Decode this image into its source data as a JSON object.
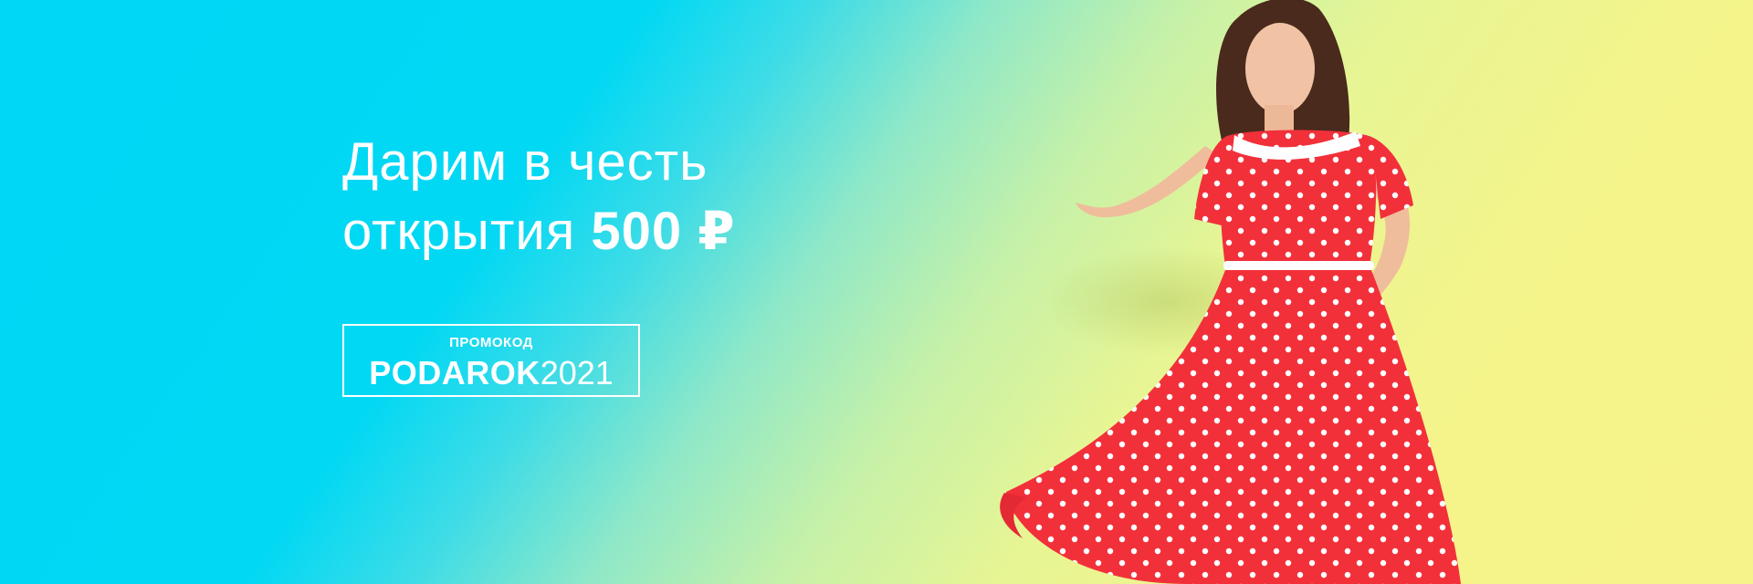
{
  "banner": {
    "headline_line1": "Дарим в честь",
    "headline_line2_prefix": "открытия ",
    "headline_amount": "500 ₽",
    "promo_label": "ПРОМОКОД",
    "promo_code_bold": "PODAROK",
    "promo_code_light": "2021",
    "colors": {
      "gradient_left": "#00d6f6",
      "gradient_right": "#f6f38a",
      "text": "#ffffff",
      "dress_red": "#f2303a"
    }
  }
}
